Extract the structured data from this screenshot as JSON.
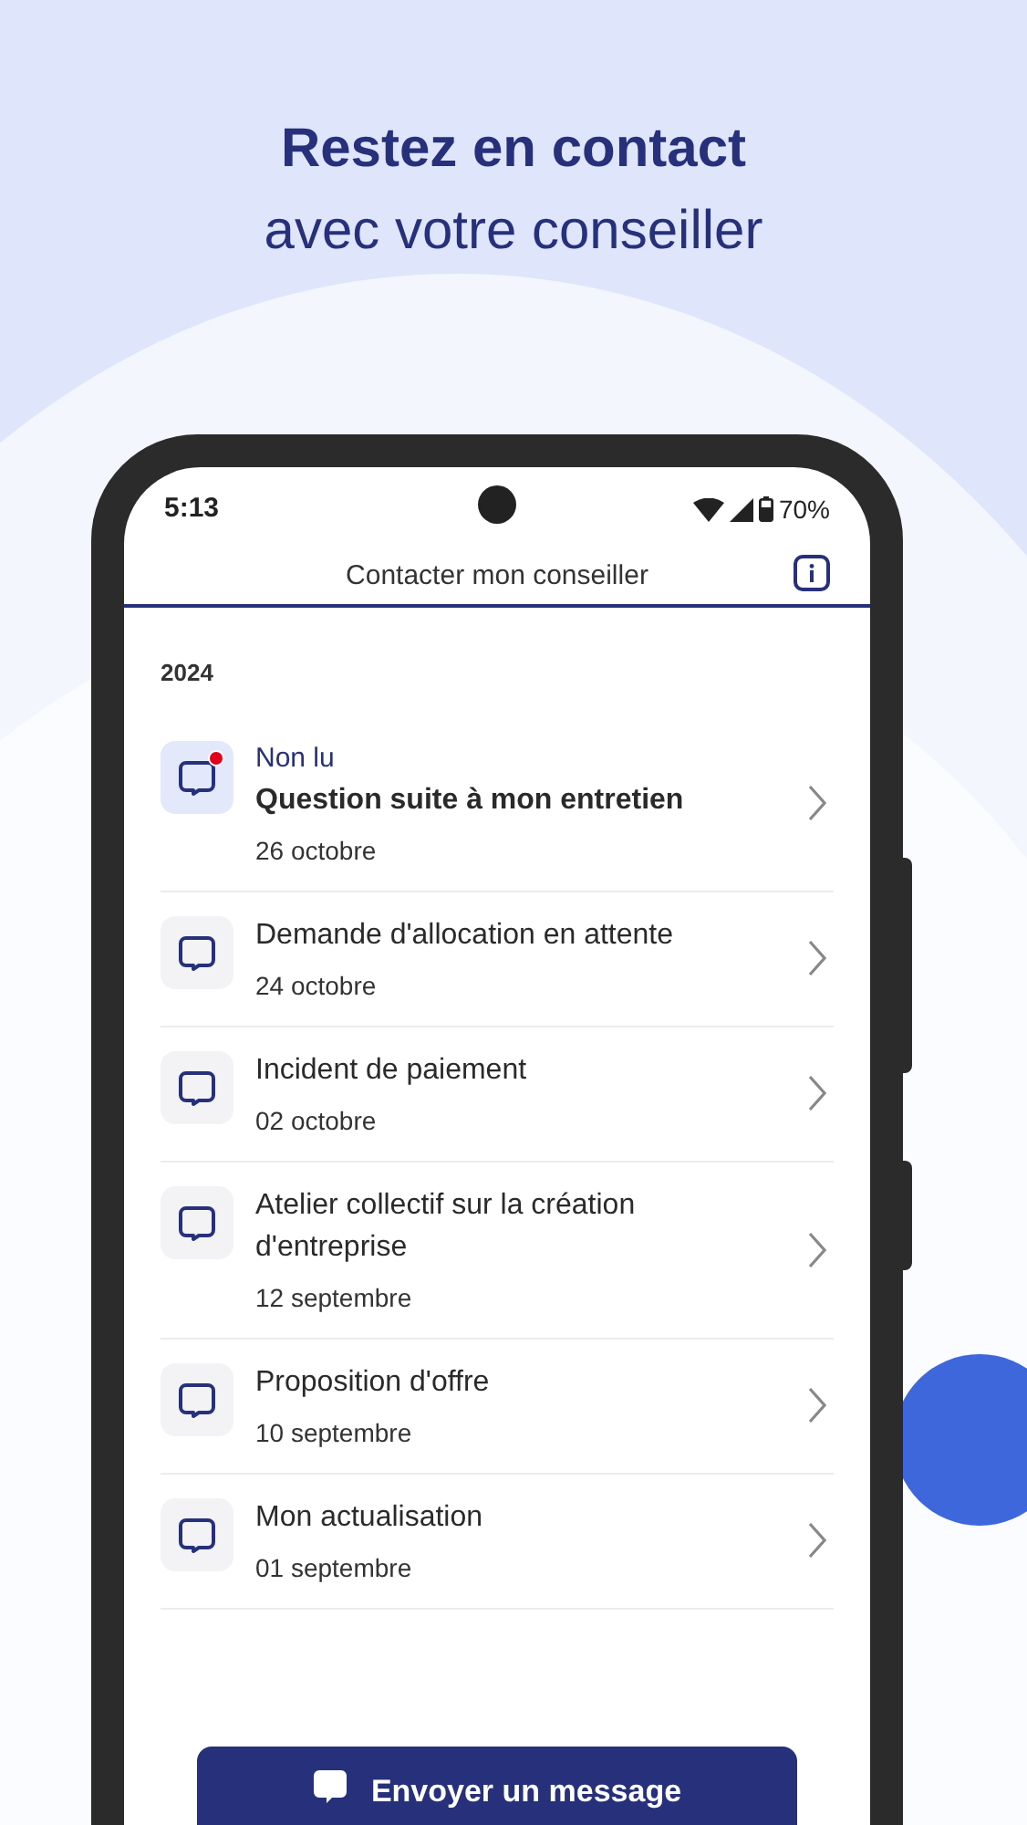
{
  "headline": {
    "title": "Restez en contact",
    "subtitle": "avec votre conseiller"
  },
  "status_bar": {
    "time": "5:13",
    "battery": "70%"
  },
  "header": {
    "title": "Contacter mon conseiller"
  },
  "section": "2024",
  "messages": [
    {
      "status": "Non lu",
      "title": "Question suite à mon entretien",
      "date": "26 octobre",
      "unread": true
    },
    {
      "title": "Demande d'allocation en attente",
      "date": "24 octobre",
      "unread": false
    },
    {
      "title": "Incident de paiement",
      "date": "02 octobre",
      "unread": false
    },
    {
      "title": "Atelier collectif sur la création d'entreprise",
      "date": "12 septembre",
      "unread": false
    },
    {
      "title": "Proposition d'offre",
      "date": "10 septembre",
      "unread": false
    },
    {
      "title": "Mon actualisation",
      "date": "01 septembre",
      "unread": false
    }
  ],
  "send_button": "Envoyer un message"
}
